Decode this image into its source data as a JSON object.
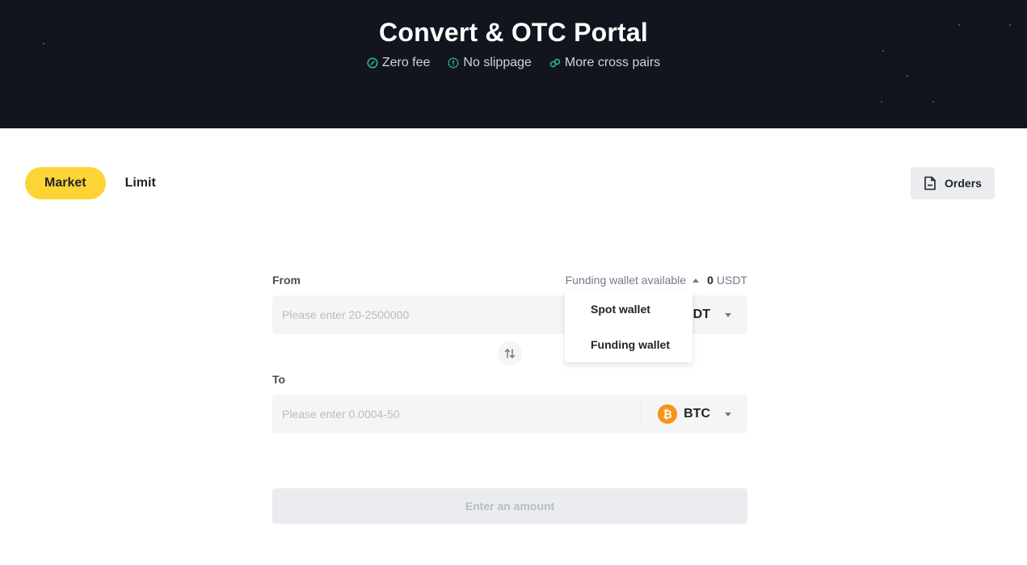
{
  "hero": {
    "title": "Convert & OTC Portal",
    "features": [
      {
        "icon": "zero-fee-icon",
        "label": "Zero fee"
      },
      {
        "icon": "no-slippage-icon",
        "label": "No slippage"
      },
      {
        "icon": "link-icon",
        "label": "More cross pairs"
      }
    ],
    "accent_color": "#2ebd85"
  },
  "tabs": [
    {
      "label": "Market",
      "active": true
    },
    {
      "label": "Limit",
      "active": false
    }
  ],
  "orders_button": {
    "label": "Orders",
    "icon": "document-icon"
  },
  "from": {
    "label": "From",
    "wallet_label": "Funding wallet available",
    "available_amount": "0",
    "available_unit": "USDT",
    "placeholder": "Please enter 20-2500000",
    "coin": "USDT"
  },
  "wallet_dropdown": {
    "options": [
      "Spot wallet",
      "Funding wallet"
    ]
  },
  "swap_button": {
    "icon": "swap-arrows-icon"
  },
  "to": {
    "label": "To",
    "placeholder": "Please enter 0.0004-50",
    "coin": "BTC",
    "coin_icon_glyph": "₿"
  },
  "submit_button": {
    "label": "Enter an amount"
  },
  "colors": {
    "brand_yellow": "#fcd535",
    "btc_orange": "#f7931a",
    "hero_bg": "#12151d"
  }
}
